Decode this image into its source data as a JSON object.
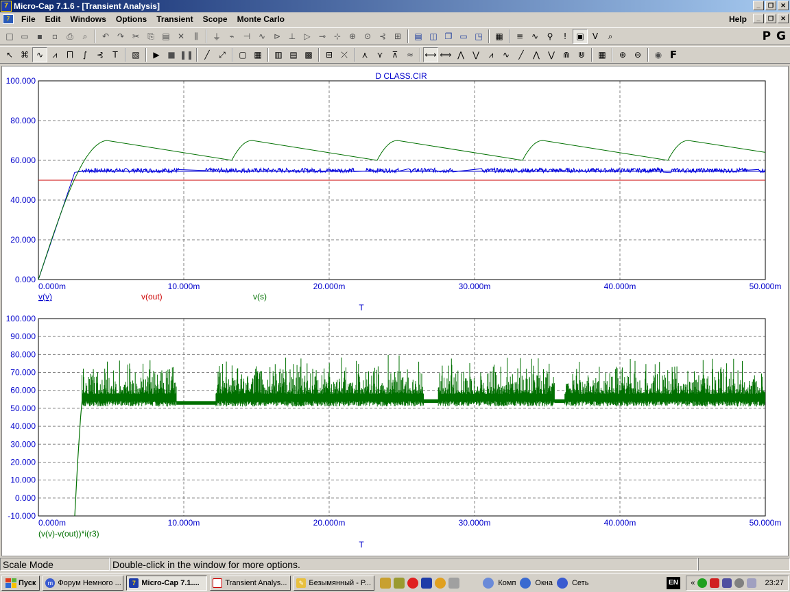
{
  "window": {
    "title": "Micro-Cap 7.1.6 - [Transient Analysis]",
    "app_icon": "7"
  },
  "menu": {
    "items": [
      "File",
      "Edit",
      "Windows",
      "Options",
      "Transient",
      "Scope",
      "Monte Carlo"
    ],
    "help": "Help"
  },
  "toolbar": {
    "big_buttons": [
      "P",
      "G"
    ]
  },
  "plot1": {
    "title": "D CLASS.CIR",
    "y_ticks": [
      "100.000",
      "80.000",
      "60.000",
      "40.000",
      "20.000",
      "0.000"
    ],
    "x_ticks": [
      "0.000m",
      "10.000m",
      "20.000m",
      "30.000m",
      "40.000m",
      "50.000m"
    ],
    "traces": [
      {
        "label": "v(v)",
        "color": "#0000cc"
      },
      {
        "label": "v(out)",
        "color": "#cc0000"
      },
      {
        "label": "v(s)",
        "color": "#007000"
      }
    ],
    "x_axis_label": "T"
  },
  "plot2": {
    "y_ticks": [
      "100.000",
      "90.000",
      "80.000",
      "70.000",
      "60.000",
      "50.000",
      "40.000",
      "30.000",
      "20.000",
      "10.000",
      "0.000",
      "-10.000"
    ],
    "x_ticks": [
      "0.000m",
      "10.000m",
      "20.000m",
      "30.000m",
      "40.000m",
      "50.000m"
    ],
    "trace_label": "(v(v)-v(out))*i(r3)",
    "trace_color": "#007000",
    "x_axis_label": "T"
  },
  "chart_data": [
    {
      "type": "line",
      "title": "D CLASS.CIR",
      "xlabel": "T",
      "xlim": [
        0,
        0.05
      ],
      "ylim": [
        0,
        100
      ],
      "series": [
        {
          "name": "v(v)",
          "x": [
            0,
            0.0025,
            0.003,
            0.05
          ],
          "values": [
            0,
            54,
            54.5,
            54.5
          ]
        },
        {
          "name": "v(out)",
          "x": [
            0,
            0.05
          ],
          "values": [
            50,
            50
          ]
        },
        {
          "name": "v(s)",
          "x": [
            0,
            0.002,
            0.0047,
            0.0133,
            0.0147,
            0.0233,
            0.0247,
            0.0333,
            0.0347,
            0.0433,
            0.0447,
            0.05
          ],
          "values": [
            0,
            45,
            70,
            60,
            70,
            60,
            70,
            60,
            70,
            60,
            70,
            64
          ]
        }
      ]
    },
    {
      "type": "line",
      "xlabel": "T",
      "xlim": [
        0,
        0.05
      ],
      "ylim": [
        -10,
        100
      ],
      "series": [
        {
          "name": "(v(v)-v(out))*i(r3)",
          "x": [
            0.0025,
            0.003,
            0.005,
            0.0095,
            0.0125,
            0.022,
            0.0235,
            0.0265,
            0.0275,
            0.0355,
            0.0365,
            0.05
          ],
          "values": [
            -10,
            58,
            55,
            53,
            54,
            56,
            54,
            53,
            54,
            54,
            54,
            57
          ]
        }
      ]
    }
  ],
  "status": {
    "mode": "Scale Mode",
    "hint": "Double-click in the window for more options."
  },
  "taskbar": {
    "start": "Пуск",
    "tasks": [
      "Форум Немного ...",
      "Micro-Cap 7.1....",
      "Transient Analys...",
      "Безымянный - P..."
    ],
    "links": [
      "Комп",
      "Окна",
      "Сеть"
    ],
    "lang": "EN",
    "clock": "23:27"
  }
}
